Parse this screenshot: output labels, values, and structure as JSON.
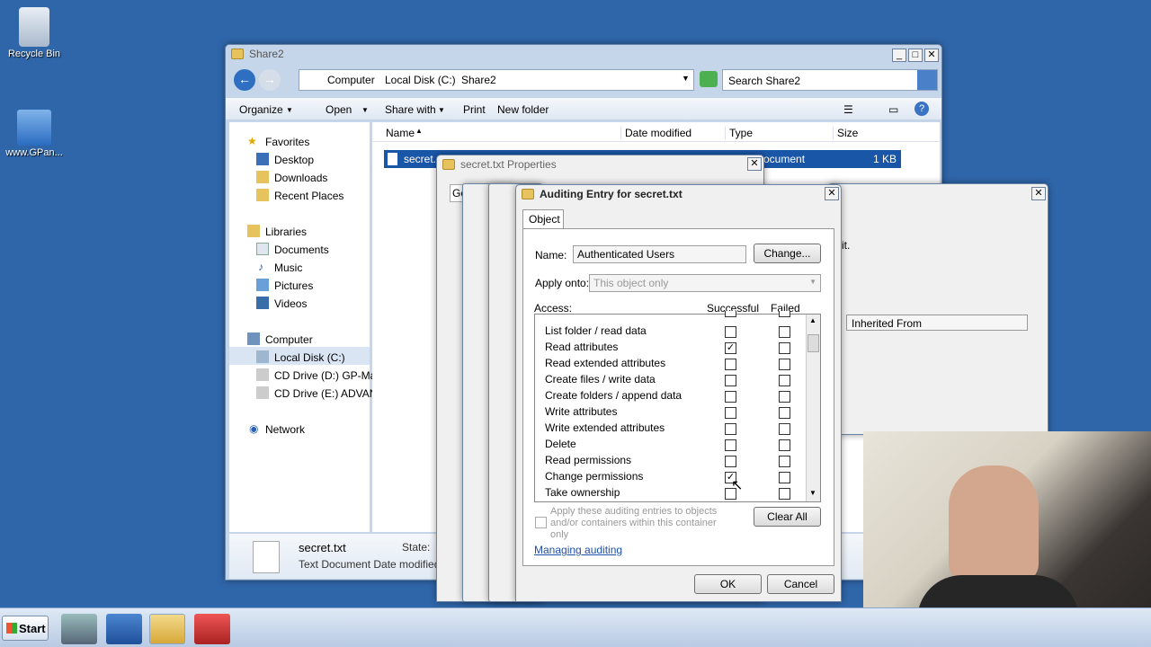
{
  "desktop": {
    "icons": [
      {
        "label": "Recycle Bin"
      },
      {
        "label": "www.GPan..."
      }
    ]
  },
  "explorer": {
    "title": "Share2",
    "breadcrumb": [
      "Computer",
      "Local Disk (C:)",
      "Share2"
    ],
    "search_placeholder": "Search Share2",
    "toolbar": {
      "organize": "Organize",
      "open": "Open",
      "share": "Share with",
      "print": "Print",
      "new_folder": "New folder"
    },
    "columns": [
      "Name",
      "Date modified",
      "Type",
      "Size"
    ],
    "file": {
      "name": "secret.",
      "type": "ocument",
      "size": "1 KB"
    },
    "nav": {
      "favorites": "Favorites",
      "desktop": "Desktop",
      "downloads": "Downloads",
      "recent": "Recent Places",
      "libraries": "Libraries",
      "documents": "Documents",
      "music": "Music",
      "pictures": "Pictures",
      "videos": "Videos",
      "computer": "Computer",
      "local": "Local Disk (C:)",
      "cd_d": "CD Drive (D:) GP-Main",
      "cd_e": "CD Drive (E:) ADVANC",
      "network": "Network"
    },
    "details": {
      "name": "secret.txt",
      "state": "State:",
      "type_line": "Text Document Date modified:"
    }
  },
  "properties": {
    "title": "secret.txt Properties",
    "tab": "Ge"
  },
  "advanced": {
    "column": "Inherited From",
    "text_fragment": "it."
  },
  "audit": {
    "title": "Auditing Entry for secret.txt",
    "tab": "Object",
    "name_label": "Name:",
    "name_value": "Authenticated Users",
    "change_button": "Change...",
    "apply_label": "Apply onto:",
    "apply_value": "This object only",
    "access_label": "Access:",
    "successful_label": "Successful",
    "failed_label": "Failed",
    "rows": [
      {
        "label": "List folder / read data",
        "success": false,
        "failed": false
      },
      {
        "label": "Read attributes",
        "success": true,
        "failed": false
      },
      {
        "label": "Read extended attributes",
        "success": false,
        "failed": false
      },
      {
        "label": "Create files / write data",
        "success": false,
        "failed": false
      },
      {
        "label": "Create folders / append data",
        "success": false,
        "failed": false
      },
      {
        "label": "Write attributes",
        "success": false,
        "failed": false
      },
      {
        "label": "Write extended attributes",
        "success": false,
        "failed": false
      },
      {
        "label": "Delete",
        "success": false,
        "failed": false
      },
      {
        "label": "Read permissions",
        "success": false,
        "failed": false
      },
      {
        "label": "Change permissions",
        "success": true,
        "failed": false
      },
      {
        "label": "Take ownership",
        "success": false,
        "failed": false
      }
    ],
    "apply_check_text": "Apply these auditing entries to objects and/or containers within this container only",
    "clear_all": "Clear All",
    "managing_link": "Managing auditing",
    "ok": "OK",
    "cancel": "Cancel"
  },
  "taskbar": {
    "start": "Start"
  }
}
